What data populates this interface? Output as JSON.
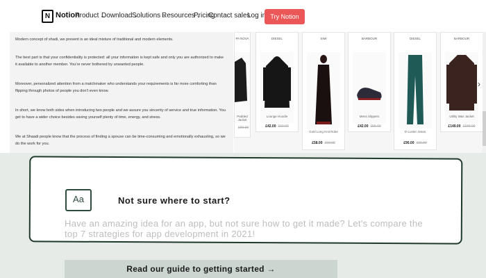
{
  "nav": {
    "brand": "Notion",
    "logo_glyph": "N",
    "items": [
      {
        "label": "Product",
        "chevron": "⌄"
      },
      {
        "label": "Download",
        "chevron": "⌄"
      },
      {
        "label": "Solutions",
        "chevron": "⌄"
      },
      {
        "label": "Resources",
        "chevron": "⌄"
      },
      {
        "label": "Pricing",
        "chevron": ""
      }
    ],
    "contact_sales": "Contact sales",
    "login": "Log in",
    "cta": "Try Notion free",
    "cta_color": "#eb5757"
  },
  "article": {
    "paragraphs": [
      "Modern concept of shadi, we present is an ideal mixture of traditional and modern elements.",
      "The best part is that your confidentiality is protected: all your information is kept safe and only you are authorized to make it available to another member. You're never bothered by unwanted people.",
      "Moreover, personalized attention from a matchmaker who understands your requirements is far more comforting than flipping through photos of people you don't even know.",
      "In short, we know both sides when introducing two people and we assure you sincerity of service and true information. You get to have a wider choice besides saving yourself plenty of time, energy, and stress.",
      "We at Shaadi people know that the process of finding a spouse can be time-consuming and emotionally exhausting, so we do the work for you."
    ]
  },
  "products": [
    {
      "brand": "PA NOVA",
      "name": "Padded Jacket",
      "price": "",
      "old_price": "£59.99",
      "icon": "jacket-icon"
    },
    {
      "brand": "DIESEL",
      "name": "Lounge Hoodie",
      "price": "£42.00",
      "old_price": "£60.00",
      "icon": "hoodie-icon"
    },
    {
      "brand": "SIMI",
      "name": "Gold Long Knit Robe",
      "price": "£58.00",
      "old_price": "£69.99",
      "icon": "robe-icon"
    },
    {
      "brand": "BARBOUR",
      "name": "Mens Slippers",
      "price": "£42.00",
      "old_price": "£55.00",
      "icon": "slipper-icon"
    },
    {
      "brand": "DIESEL",
      "name": "D-Luster Jeans",
      "price": "£90.00",
      "old_price": "£99.99",
      "icon": "jeans-icon"
    },
    {
      "brand": "BARBOUR",
      "name": "Utility Wax Jacket",
      "price": "£149.00",
      "old_price": "£189.00",
      "icon": "wax-jacket-icon"
    }
  ],
  "carousel_next_glyph": "›",
  "callout": {
    "icon_glyph": "Aa",
    "title": "Not sure where to start?",
    "body": "Have an amazing idea for an app, but not sure how to get it made? Let's compare the top 7 strategies for app development in 2021!",
    "button": "Read our guide to getting started →"
  },
  "colors": {
    "callout_border": "#1e3a2b",
    "section_bg": "#e7ebe8",
    "button_bg": "#cbd6d0"
  }
}
